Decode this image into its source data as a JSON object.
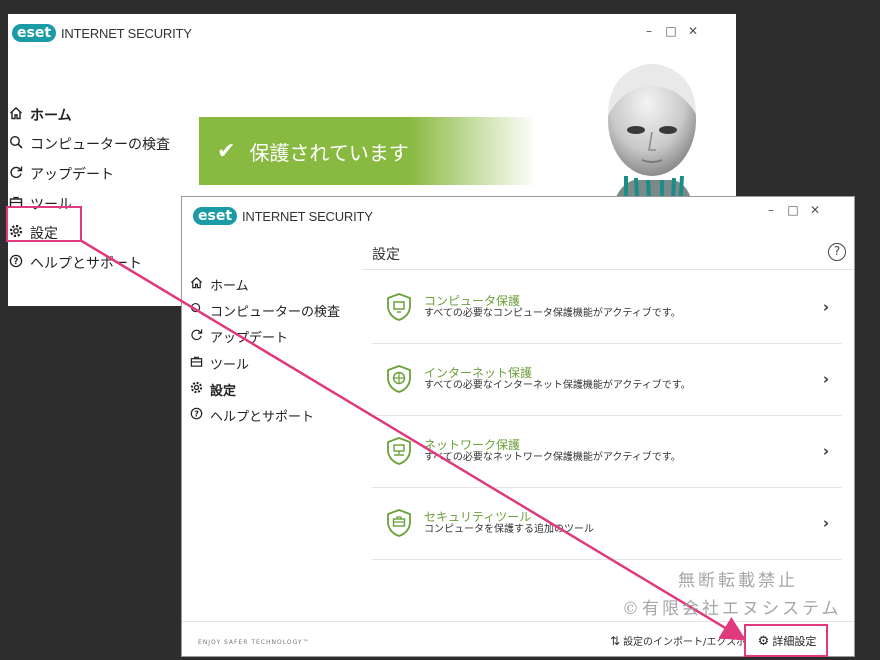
{
  "colors": {
    "brand_teal": "#1a9ba6",
    "protect_green": "#88b940",
    "card_green": "#6aa03a",
    "highlight_pink": "#e0397e"
  },
  "back_window": {
    "logo_badge": "eset",
    "logo_text": "INTERNET SECURITY",
    "controls": [
      "–",
      "□",
      "✕"
    ],
    "nav": [
      {
        "icon": "home-icon",
        "label": "ホーム"
      },
      {
        "icon": "search-icon",
        "label": "コンピューターの検査"
      },
      {
        "icon": "refresh-icon",
        "label": "アップデート"
      },
      {
        "icon": "toolbox-icon",
        "label": "ツール"
      },
      {
        "icon": "gear-icon",
        "label": "設定"
      },
      {
        "icon": "help-circle-icon",
        "label": "ヘルプとサポート"
      }
    ],
    "status_text": "保護されています"
  },
  "front_window": {
    "logo_badge": "eset",
    "logo_text": "INTERNET SECURITY",
    "controls": [
      "–",
      "□",
      "✕"
    ],
    "nav": [
      {
        "icon": "home-icon",
        "label": "ホーム"
      },
      {
        "icon": "search-icon",
        "label": "コンピューターの検査"
      },
      {
        "icon": "refresh-icon",
        "label": "アップデート"
      },
      {
        "icon": "toolbox-icon",
        "label": "ツール"
      },
      {
        "icon": "gear-icon",
        "label": "設定"
      },
      {
        "icon": "help-circle-icon",
        "label": "ヘルプとサポート"
      }
    ],
    "page_title": "設定",
    "help_label": "?",
    "cards": [
      {
        "title": "コンピュータ保護",
        "desc": "すべての必要なコンピュータ保護機能がアクティブです。",
        "icon": "monitor-shield-icon"
      },
      {
        "title": "インターネット保護",
        "desc": "すべての必要なインターネット保護機能がアクティブです。",
        "icon": "globe-shield-icon"
      },
      {
        "title": "ネットワーク保護",
        "desc": "すべての必要なネットワーク保護機能がアクティブです。",
        "icon": "network-shield-icon"
      },
      {
        "title": "セキュリティツール",
        "desc": "コンピュータを保護する追加のツール",
        "icon": "toolbox-shield-icon"
      }
    ],
    "tagline": "ENJOY SAFER TECHNOLOGY™",
    "import_export": "設定のインポート/エクスポート",
    "advanced_setup": "詳細設定"
  },
  "watermark": {
    "line1": "無断転載禁止",
    "line2": "©有限会社エヌシステム"
  }
}
